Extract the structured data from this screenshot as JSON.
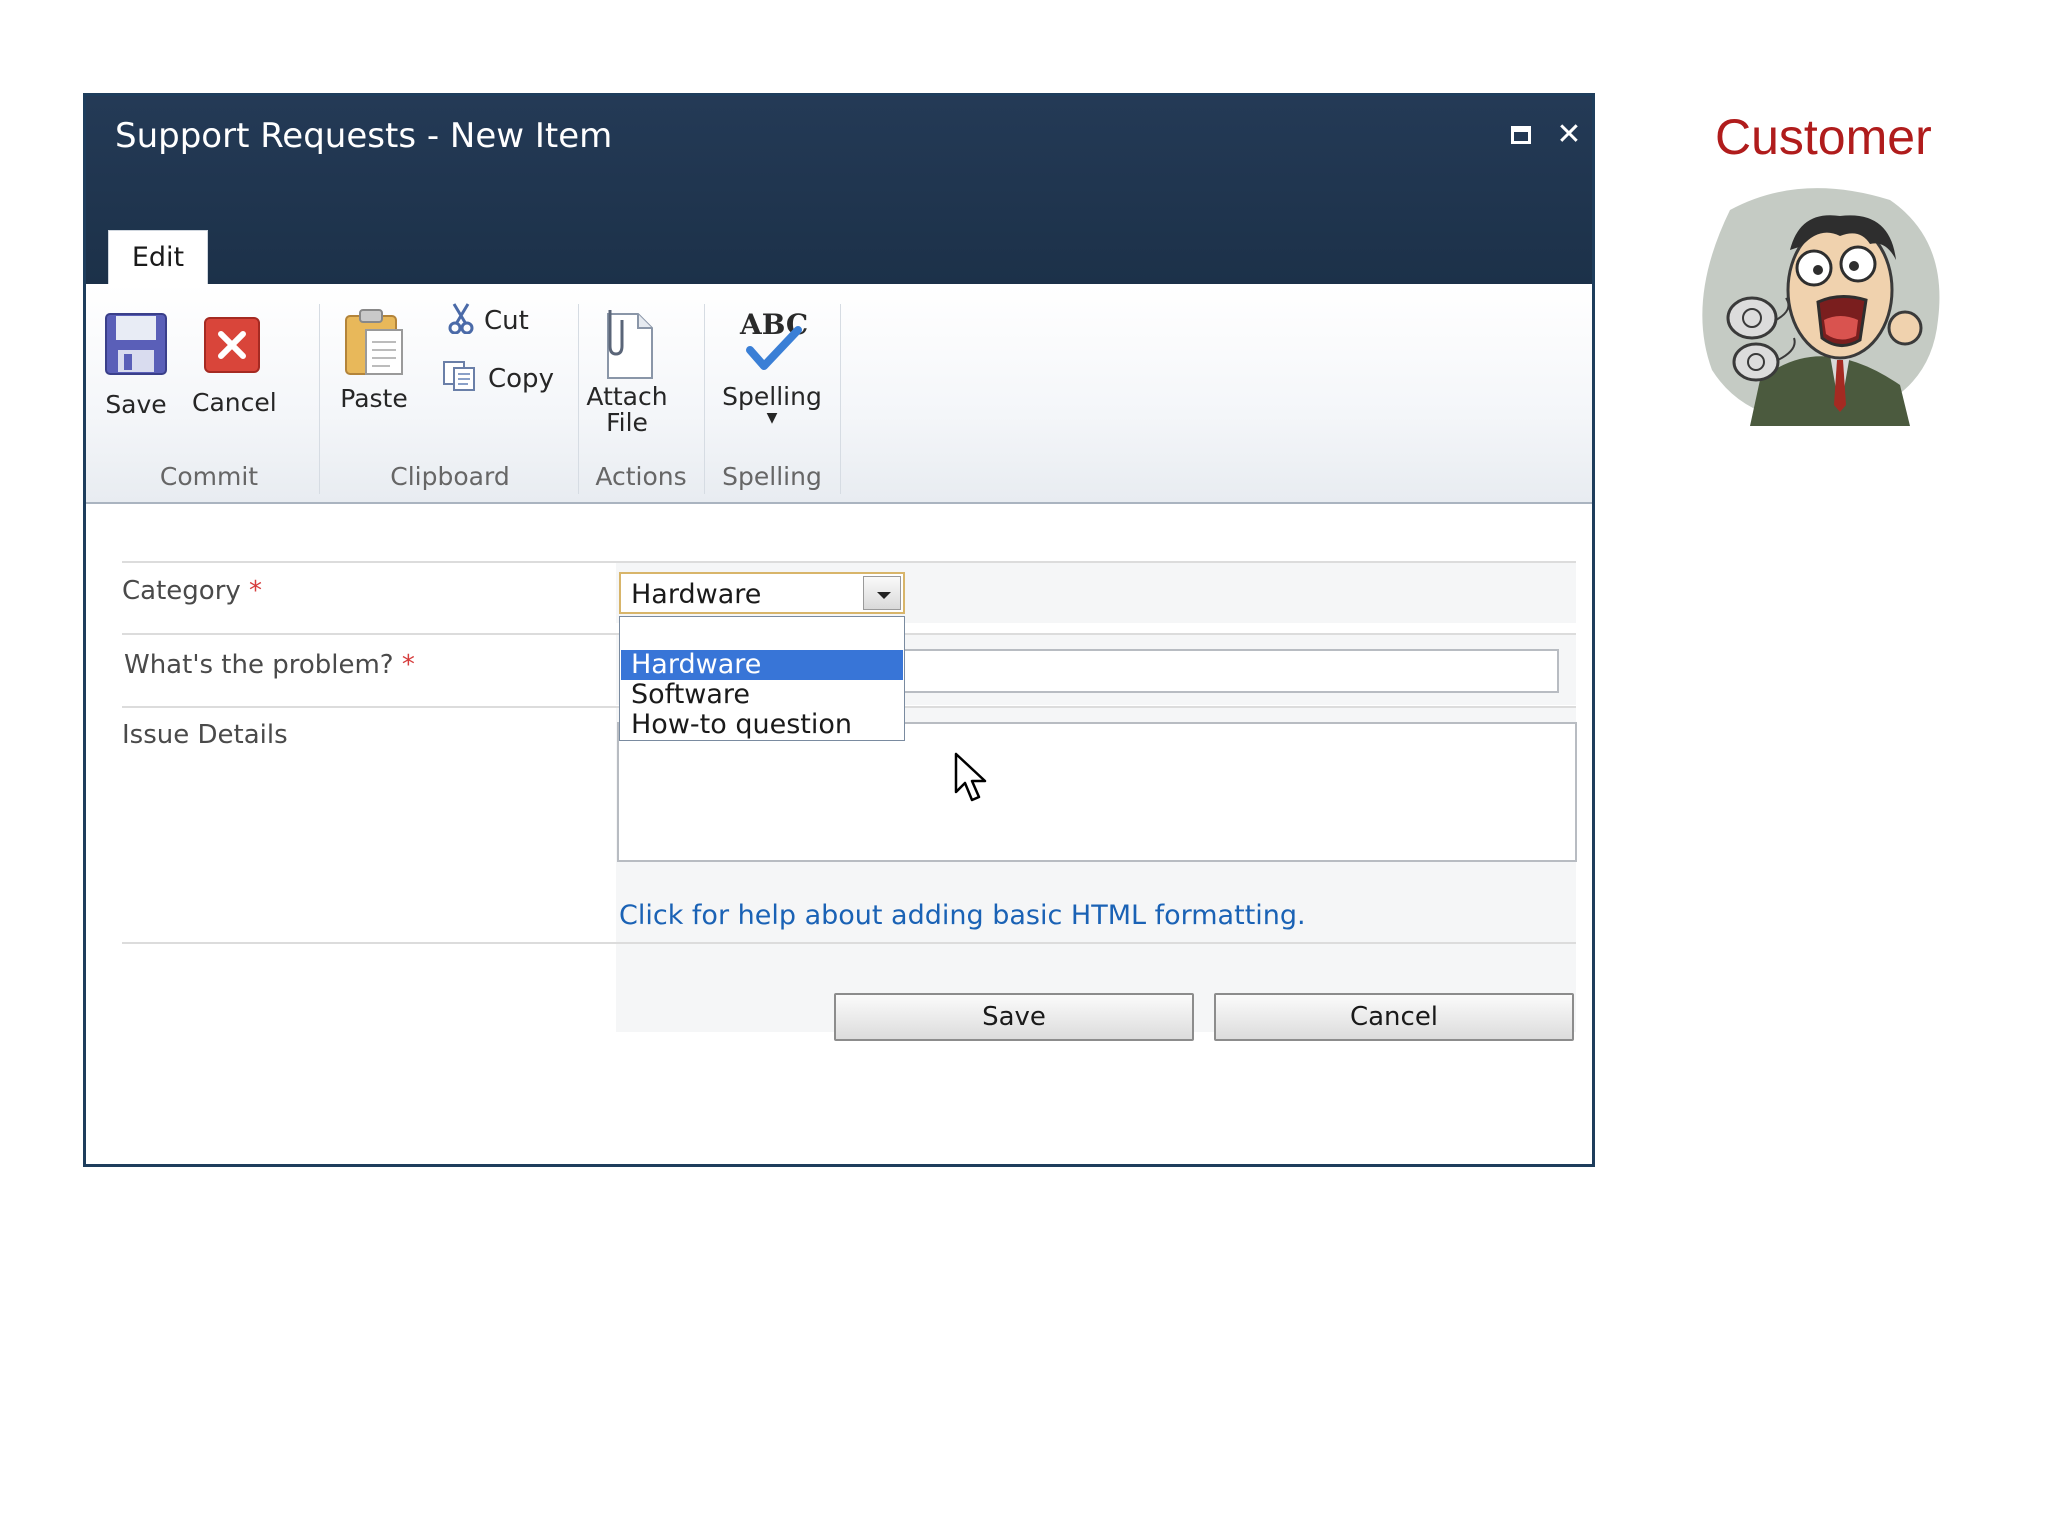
{
  "dialog": {
    "title": "Support Requests - New Item",
    "tab": "Edit"
  },
  "ribbon": {
    "save": "Save",
    "cancel": "Cancel",
    "paste": "Paste",
    "cut": "Cut",
    "copy": "Copy",
    "attach_line1": "Attach",
    "attach_line2": "File",
    "spelling": "Spelling",
    "groups": {
      "commit": "Commit",
      "clipboard": "Clipboard",
      "actions": "Actions",
      "spelling": "Spelling"
    }
  },
  "form": {
    "category_label": "Category",
    "problem_label": "What's the problem?",
    "details_label": "Issue Details",
    "required_mark": "*",
    "category_value": "Hardware",
    "category_options": [
      "Hardware",
      "Software",
      "How-to question"
    ],
    "help_link": "Click for help about adding basic HTML formatting.",
    "save_button": "Save",
    "cancel_button": "Cancel"
  },
  "customer": {
    "label": "Customer"
  },
  "colors": {
    "titlebar": "#243a56",
    "selected_option": "#3875d7",
    "link": "#1a62b5",
    "required": "#d63d3d",
    "customer_label": "#b01c1c"
  }
}
